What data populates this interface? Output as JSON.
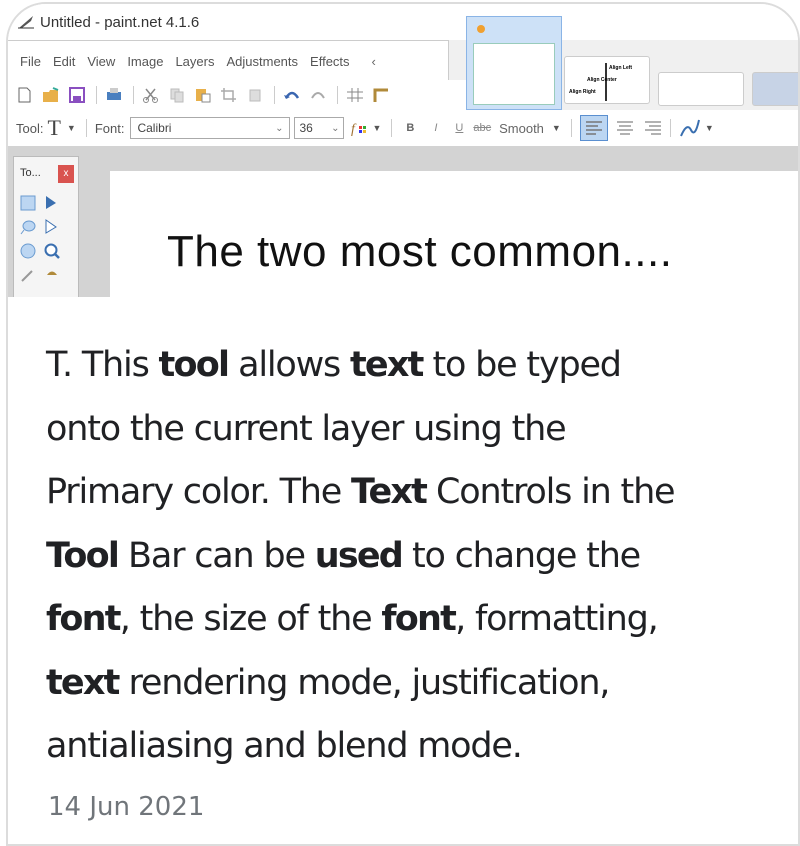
{
  "window": {
    "title": "Untitled - paint.net 4.1.6",
    "app_icon": "paintnet-icon"
  },
  "menu": {
    "items": [
      "File",
      "Edit",
      "View",
      "Image",
      "Layers",
      "Adjustments",
      "Effects"
    ],
    "scroll_left": "‹"
  },
  "icon_toolbar": {
    "icons": [
      "new-file-icon",
      "open-folder-icon",
      "save-icon",
      "print-icon",
      "cut-icon",
      "copy-icon",
      "paste-icon",
      "crop-icon",
      "deselect-icon",
      "undo-icon",
      "redo-icon",
      "grid-icon",
      "ruler-icon"
    ]
  },
  "tool_bar": {
    "tool_label": "Tool:",
    "tool_glyph": "T",
    "font_label": "Font:",
    "font_value": "Calibri",
    "size_value": "36",
    "bold": "B",
    "italic": "I",
    "underline": "U",
    "strike": "abc",
    "antialias_value": "Smooth",
    "align_active": "left"
  },
  "thumbnails": {
    "align_left": "Align Left",
    "align_center": "Align Center",
    "align_right": "Align Right"
  },
  "tools_panel": {
    "title": "To...",
    "close": "x"
  },
  "canvas": {
    "text": "The two most common...."
  },
  "description": {
    "lines": [
      [
        {
          "t": "T. This "
        },
        {
          "t": "tool",
          "b": true
        },
        {
          "t": " allows "
        },
        {
          "t": "text",
          "b": true
        },
        {
          "t": " to be typed"
        }
      ],
      [
        {
          "t": "onto the current layer using the"
        }
      ],
      [
        {
          "t": "Primary color. The "
        },
        {
          "t": "Text",
          "b": true
        },
        {
          "t": " Controls in the"
        }
      ],
      [
        {
          "t": "Tool",
          "b": true
        },
        {
          "t": " Bar can be "
        },
        {
          "t": "used",
          "b": true
        },
        {
          "t": " to change the"
        }
      ],
      [
        {
          "t": "font",
          "b": true
        },
        {
          "t": ", the size of the "
        },
        {
          "t": "font",
          "b": true
        },
        {
          "t": ", formatting,"
        }
      ],
      [
        {
          "t": "text",
          "b": true
        },
        {
          "t": " rendering mode, justification,"
        }
      ],
      [
        {
          "t": "antialiasing and blend mode."
        }
      ]
    ],
    "date": "14 Jun 2021"
  }
}
